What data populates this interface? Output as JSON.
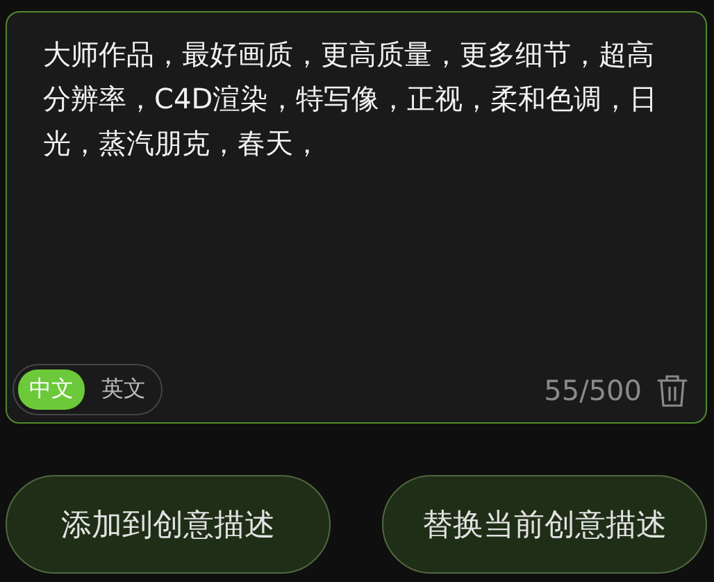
{
  "prompt": {
    "value": "大师作品，最好画质，更高质量，更多细节，超高分辨率，C4D渲染，特写像，正视，柔和色调，日光，蒸汽朋克，春天，"
  },
  "languages": [
    {
      "label": "中文",
      "selected": true
    },
    {
      "label": "英文",
      "selected": false
    }
  ],
  "counter": "55/500",
  "buttons": [
    "添加到创意描述",
    "替换当前创意描述"
  ]
}
